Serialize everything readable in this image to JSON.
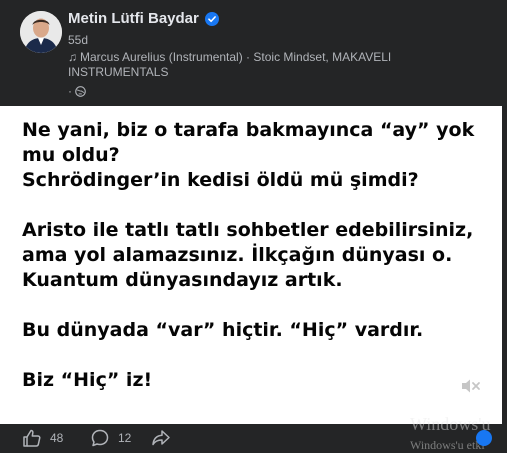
{
  "post": {
    "author": "Metin Lütfi Baydar",
    "time": "55d",
    "music": "Marcus Aurelius (Instrumental) · Stoic Mindset, MAKAVELI INSTRUMENTALS",
    "privacy_sep": "·",
    "text_lines": [
      "Ne yani, biz o tarafa bakmayınca “ay” yok",
      "mu oldu?",
      "Schrödinger’in  kedisi öldü mü şimdi?",
      "",
      "Aristo ile tatlı tatlı sohbetler edebilirsiniz,",
      "ama yol alamazsınız. İlkçağın dünyası o.",
      "Kuantum  dünyasındayız artık.",
      "",
      "Bu dünyada “var” hiçtir. “Hiç” vardır.",
      "",
      "Biz “Hiç” iz!"
    ]
  },
  "footer": {
    "likes": "48",
    "comments": "12"
  },
  "watermark": {
    "line1": "Windows'u",
    "line2": "Windows'u etki"
  },
  "colors": {
    "background": "#242526",
    "card": "#ffffff",
    "verified": "#1877f2"
  },
  "icons": [
    "verified-icon",
    "music-note-icon",
    "globe-icon",
    "like-icon",
    "comment-icon",
    "share-icon",
    "mute-icon"
  ]
}
